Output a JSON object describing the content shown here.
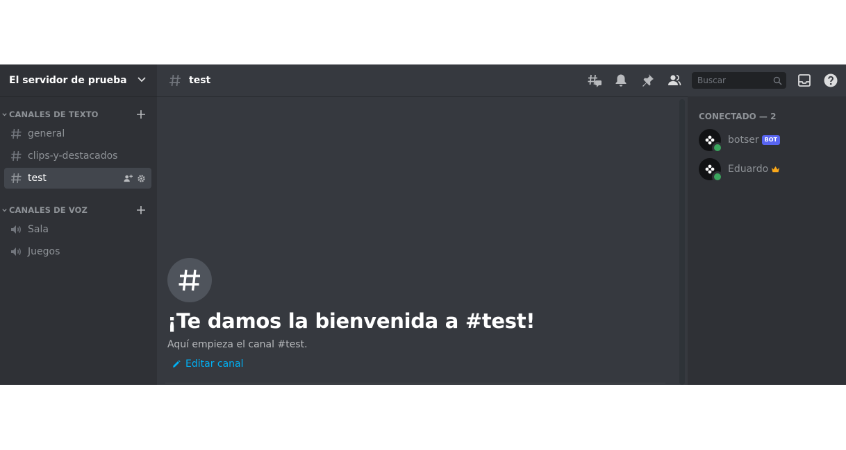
{
  "server": {
    "name": "El servidor de prueba"
  },
  "sidebar": {
    "text_category": "CANALES DE TEXTO",
    "text_channels": [
      {
        "label": "general"
      },
      {
        "label": "clips-y-destacados"
      },
      {
        "label": "test",
        "active": true
      }
    ],
    "voice_category": "CANALES DE VOZ",
    "voice_channels": [
      {
        "label": "Sala"
      },
      {
        "label": "Juegos"
      }
    ]
  },
  "header": {
    "channel": "test",
    "search_placeholder": "Buscar"
  },
  "welcome": {
    "title": "¡Te damos la bienvenida a #test!",
    "subtitle": "Aquí empieza el canal #test.",
    "edit_label": "Editar canal"
  },
  "members": {
    "header": "CONECTADO — 2",
    "list": [
      {
        "name": "botser",
        "tag": "BOT",
        "status": "online"
      },
      {
        "name": "Eduardo",
        "owner": true,
        "status": "online"
      }
    ]
  },
  "colors": {
    "accent": "#5865f2",
    "link": "#00b0f4",
    "online": "#3ba55d",
    "crown": "#faa81a"
  }
}
